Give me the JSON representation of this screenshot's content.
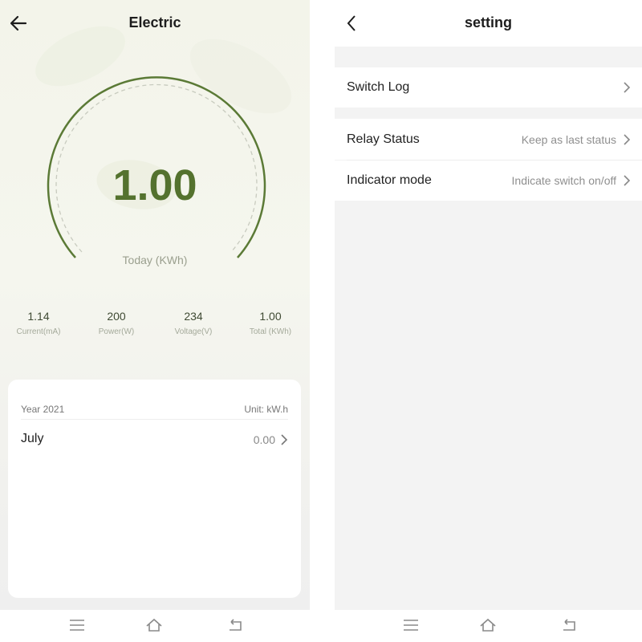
{
  "left_screen": {
    "title": "Electric",
    "gauge": {
      "value": "1.00",
      "label": "Today (KWh)"
    },
    "stats": [
      {
        "value": "1.14",
        "label": "Current(mA)"
      },
      {
        "value": "200",
        "label": "Power(W)"
      },
      {
        "value": "234",
        "label": "Voltage(V)"
      },
      {
        "value": "1.00",
        "label": "Total (KWh)"
      }
    ],
    "history": {
      "year_label": "Year 2021",
      "unit_label": "Unit: kW.h",
      "rows": [
        {
          "month": "July",
          "value": "0.00"
        }
      ]
    }
  },
  "right_screen": {
    "title": "setting",
    "rows": [
      {
        "label": "Switch Log",
        "value": ""
      },
      {
        "label": "Relay Status",
        "value": "Keep as last status"
      },
      {
        "label": "Indicator mode",
        "value": "Indicate switch on/off"
      }
    ]
  },
  "navbar": {
    "icons": [
      "menu-icon",
      "home-icon",
      "back-icon"
    ]
  },
  "colors": {
    "accent": "#54722e",
    "gauge_stroke": "#5b7a36",
    "muted_text": "#9a9f8e"
  }
}
